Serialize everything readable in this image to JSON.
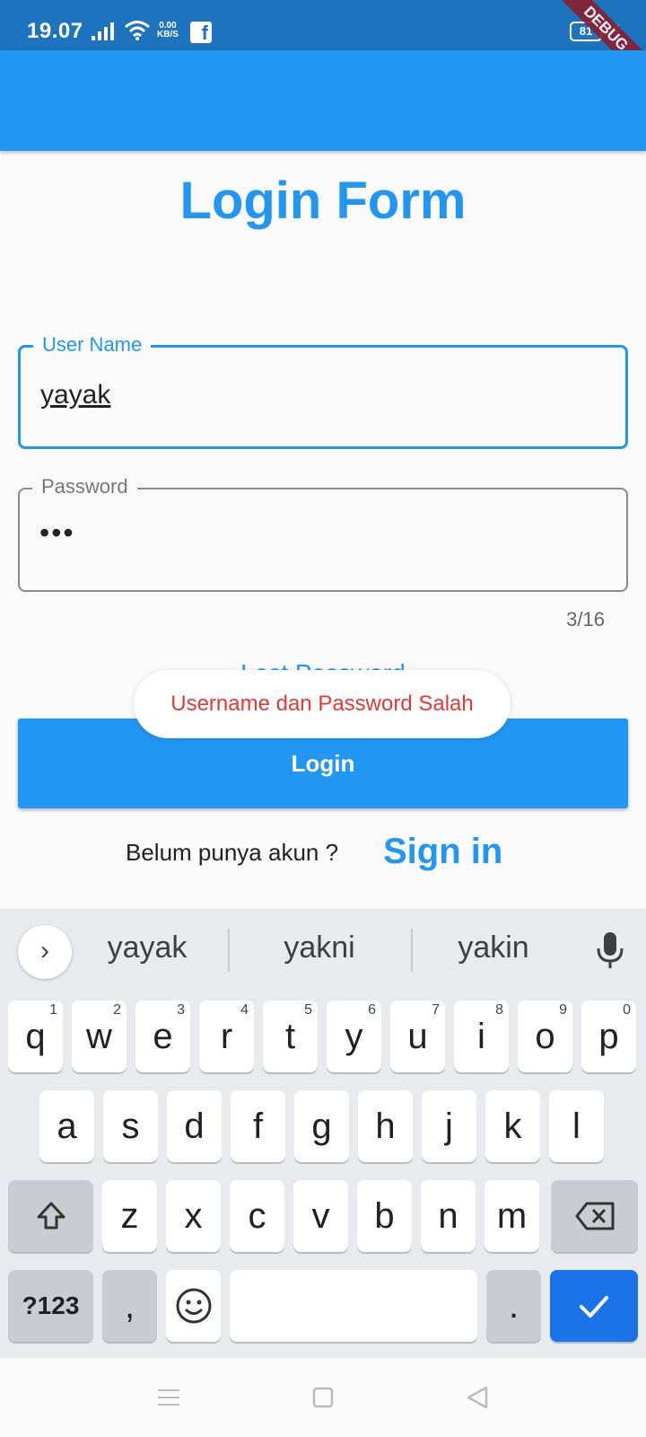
{
  "status_bar": {
    "time": "19.07",
    "net_speed_top": "0.00",
    "net_speed_bottom": "KB/S",
    "app_icon": "facebook-icon",
    "battery": "81",
    "debug_banner": "DEBUG"
  },
  "colors": {
    "primary": "#2196f3",
    "status_bar": "#1e73be",
    "error": "#e53935",
    "keyboard_bg": "#e8eaed",
    "action_key": "#1a73e8"
  },
  "page": {
    "title": "Login Form"
  },
  "form": {
    "username": {
      "label": "User Name",
      "value": "yayak"
    },
    "password": {
      "label": "Password",
      "value": "•••",
      "counter": "3/16"
    },
    "lost_password": "Lost Password",
    "toast": "Username dan Password Salah",
    "login_button": "Login",
    "signup_prompt": "Belum punya akun ?",
    "signin_link": "Sign in"
  },
  "keyboard": {
    "suggestions": [
      "yayak",
      "yakni",
      "yakin"
    ],
    "row1": [
      {
        "k": "q",
        "h": "1"
      },
      {
        "k": "w",
        "h": "2"
      },
      {
        "k": "e",
        "h": "3"
      },
      {
        "k": "r",
        "h": "4"
      },
      {
        "k": "t",
        "h": "5"
      },
      {
        "k": "y",
        "h": "6"
      },
      {
        "k": "u",
        "h": "7"
      },
      {
        "k": "i",
        "h": "8"
      },
      {
        "k": "o",
        "h": "9"
      },
      {
        "k": "p",
        "h": "0"
      }
    ],
    "row2": [
      "a",
      "s",
      "d",
      "f",
      "g",
      "h",
      "j",
      "k",
      "l"
    ],
    "row3": [
      "z",
      "x",
      "c",
      "v",
      "b",
      "n",
      "m"
    ],
    "symbols_key": "?123",
    "comma_key": ",",
    "period_key": "."
  },
  "nav_bar": {
    "icons": [
      "menu-icon",
      "home-square-icon",
      "back-triangle-icon"
    ]
  }
}
